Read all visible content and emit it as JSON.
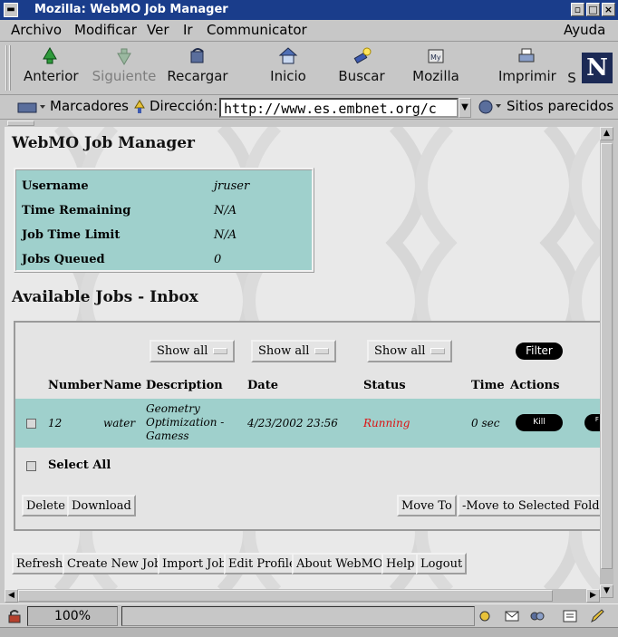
{
  "window": {
    "title": "Mozilla: WebMO Job Manager"
  },
  "menu": {
    "items": [
      "Archivo",
      "Modificar",
      "Ver",
      "Ir",
      "Communicator"
    ],
    "help": "Ayuda"
  },
  "toolbar": {
    "back": "Anterior",
    "forward": "Siguiente",
    "reload": "Recargar",
    "home": "Inicio",
    "search": "Buscar",
    "mozilla": "Mozilla",
    "print": "Imprimir",
    "stop_partial": "S"
  },
  "location": {
    "bookmarks": "Marcadores",
    "address_label": "Dirección:",
    "url": "http://www.es.embnet.org/c",
    "related": "Sitios parecidos"
  },
  "page": {
    "title": "WebMO Job Manager",
    "info": [
      {
        "key": "Username",
        "value": "jruser"
      },
      {
        "key": "Time Remaining",
        "value": "N/A"
      },
      {
        "key": "Job Time Limit",
        "value": "N/A"
      },
      {
        "key": "Jobs Queued",
        "value": "0"
      }
    ],
    "jobs_title": "Available Jobs - Inbox",
    "filters": [
      "Show all",
      "Show all",
      "Show all"
    ],
    "filter_button": "Filter",
    "columns": [
      "Number",
      "Name",
      "Description",
      "Date",
      "Status",
      "Time",
      "Actions"
    ],
    "job": {
      "number": "12",
      "name": "water",
      "description": "Geometry Optimization - Gamess",
      "date": "4/23/2002 23:56",
      "status": "Running",
      "time": "0 sec",
      "kill": "Kill",
      "second_action_partial": "F Ou"
    },
    "select_all": "Select All",
    "delete": "Delete",
    "download": "Download",
    "move_to": "Move To",
    "move_folder": "-Move to Selected Folder-",
    "footer_buttons": [
      "Refresh",
      "Create New Job",
      "Import Job",
      "Edit Profile",
      "About WebMO",
      "Help",
      "Logout"
    ]
  },
  "status": {
    "zoom": "100%"
  },
  "colors": {
    "teal": "#9fd0cc",
    "running": "#dd1111",
    "titlebar": "#1a3d8b"
  }
}
